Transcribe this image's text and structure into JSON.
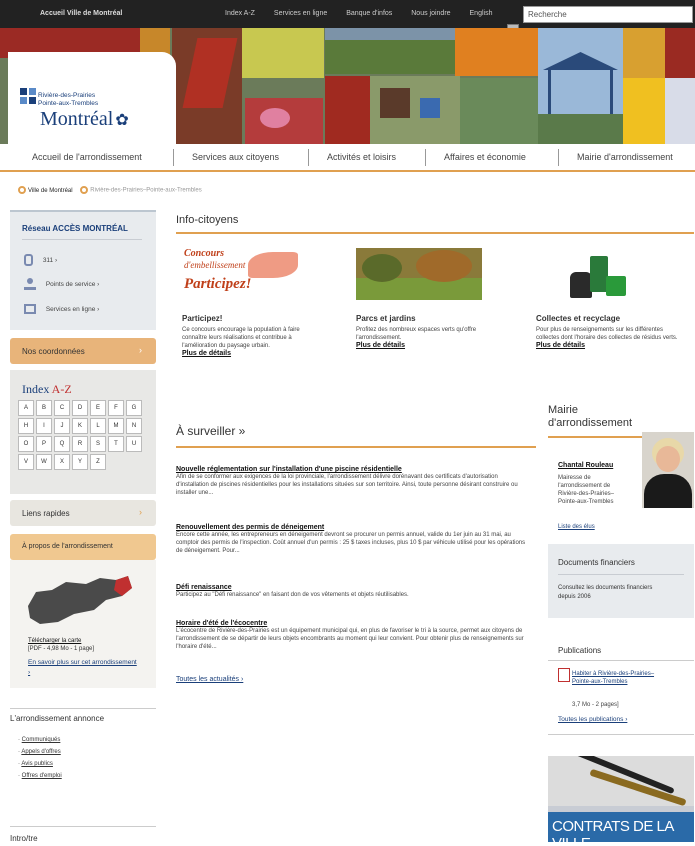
{
  "topbar": {
    "home": "Accueil Ville de Montréal",
    "links": [
      "Index A-Z",
      "Services en ligne",
      "Banque d'infos",
      "Nous joindre",
      "English"
    ],
    "search_placeholder": "Recherche"
  },
  "logo": {
    "line1": "Rivière-des-Prairies",
    "line2": "Pointe-aux-Trembles",
    "city": "Montréal"
  },
  "nav": [
    "Accueil de l'arrondissement",
    "Services aux citoyens",
    "Activités et loisirs",
    "Affaires et économie",
    "Mairie d'arrondissement"
  ],
  "breadcrumb": [
    "Ville de Montréal",
    "Rivière-des-Prairies–Pointe-aux-Trembles"
  ],
  "sidebar": {
    "acces_title": "Réseau ACCÈS MONTRÉAL",
    "acces_items": [
      "311 ›",
      "Points de service ›",
      "Services en ligne ›"
    ],
    "coordonnees": "Nos coordonnées",
    "index_title_a": "Index",
    "index_title_b": "A-Z",
    "letters": [
      "A",
      "B",
      "C",
      "D",
      "E",
      "F",
      "G",
      "H",
      "I",
      "J",
      "K",
      "L",
      "M",
      "N",
      "O",
      "P",
      "Q",
      "R",
      "S",
      "T",
      "U",
      "V",
      "W",
      "X",
      "Y",
      "Z"
    ],
    "liens": "Liens rapides",
    "apropos": "À propos de l'arrondissement",
    "map_link1": "Télécharger la carte",
    "map_link1_meta": "[PDF - 4,98 Mo - 1 page]",
    "map_link2": "En savoir plus sur cet arrondissement ›",
    "annonce_title": "L'arrondissement annonce",
    "annonce_items": [
      "Communiqués",
      "Appels d'offres",
      "Avis publics",
      "Offres d'emploi"
    ],
    "intro": "Intro/tre"
  },
  "info": {
    "title": "Info-citoyens",
    "promo_line1": "Concours",
    "promo_line2": "d'embellissement",
    "promo_line3": "Participez!",
    "cols": [
      {
        "title": "Participez!",
        "text": "Ce concours encourage la population à faire connaître leurs réalisations et contribue à l'amélioration du paysage urbain.",
        "link": "Plus de détails"
      },
      {
        "title": "Parcs et jardins",
        "text": "Profitez des nombreux espaces verts qu'offre l'arrondissement.",
        "link": "Plus de détails"
      },
      {
        "title": "Collectes et recyclage",
        "text": "Pour plus de renseignements sur les différentes collectes dont l'horaire des collectes de résidus verts.",
        "link": "Plus de détails"
      }
    ]
  },
  "surveiller": {
    "title": "À surveiller »",
    "articles": [
      {
        "title": "Nouvelle réglementation sur l'installation d'une piscine résidentielle",
        "text": "Afin de se conformer aux exigences de la loi provinciale, l'arrondissement délivre dorénavant des certificats d'autorisation d'installation de piscines résidentielles pour les installations situées sur son territoire. Ainsi, toute personne désirant construire ou installer une..."
      },
      {
        "title": "Renouvellement des permis de déneigement",
        "text": "Encore cette année, les entrepreneurs en déneigement devront se procurer un permis annuel, valide du 1er juin au 31 mai, au comptoir des permis de l'inspection. Coût annuel d'un permis : 25 $ taxes incluses, plus 10 $ par véhicule utilisé pour les opérations de déneigement. Pour..."
      },
      {
        "title": "Défi renaissance",
        "text": "Participez au \"Défi renaissance\" en faisant don de vos vêtements et objets réutilisables."
      },
      {
        "title": "Horaire d'été de l'écocentre",
        "text": "L'écocentre de Rivière-des-Prairies est un équipement municipal qui, en plus de favoriser le tri à la source, permet aux citoyens de l'arrondissement de se départir de leurs objets encombrants au moment qui leur convient. Pour obtenir plus de renseignements sur l'horaire d'été..."
      }
    ],
    "all_link": "Toutes les actualités ›"
  },
  "right": {
    "mairie_title_1": "Mairie",
    "mairie_title_2": "d'arrondissement",
    "mayor_name": "Chantal Rouleau",
    "mayor_role": "Mairesse de l'arrondissement de Rivière-des-Prairies–Pointe-aux-Trembles",
    "elus": "Liste des élus",
    "docs_title": "Documents financiers",
    "docs_text": "Consultez les documents financiers depuis 2006",
    "pubs_title": "Publications",
    "pub_link": "Habiter à Rivière-des-Prairies–Pointe-aux-Trembles",
    "pub_meta": "3,7 Mo - 2 pages]",
    "pubs_all": "Toutes les publications ›",
    "contrats": "CONTRATS DE LA VILLE"
  },
  "colors": {
    "accent": "#e0a050",
    "link": "#1a3f7a",
    "sidebar_bg": "#e8e6e0",
    "orange_tab": "#f0c890"
  }
}
